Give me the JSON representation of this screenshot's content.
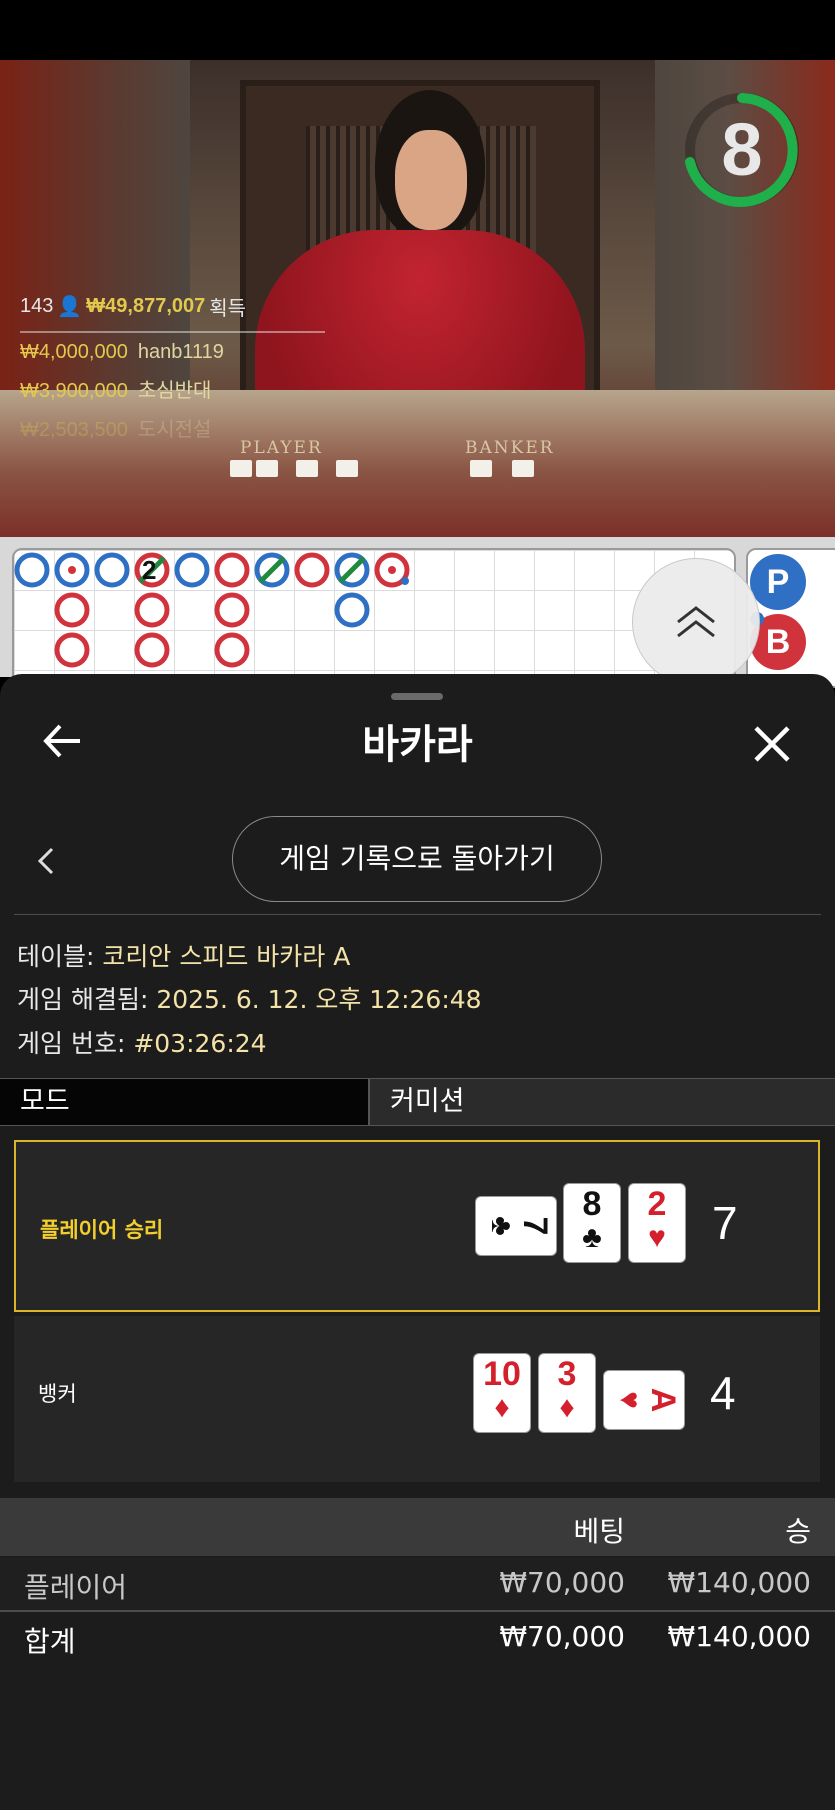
{
  "video": {
    "timer": "8",
    "table_labels": {
      "player": "PLAYER",
      "banker": "BANKER"
    },
    "winners": {
      "count": "143",
      "total": "₩49,877,007",
      "total_suffix": "획득",
      "list": [
        {
          "amount": "₩4,000,000",
          "name": "hanb1119"
        },
        {
          "amount": "₩3,900,000",
          "name": "초심반대"
        },
        {
          "amount": "₩2,503,500",
          "name": "도시전설"
        }
      ]
    }
  },
  "roadmap": {
    "side_labels": {
      "player": "P",
      "banker": "B"
    },
    "tie_count": "2"
  },
  "header": {
    "title": "바카라"
  },
  "history_button": "게임 기록으로 돌아가기",
  "info": {
    "table_label": "테이블:",
    "table_value": "코리안 스피드 바카라 A",
    "resolved_label": "게임 해결됨:",
    "resolved_value": "2025. 6. 12. 오후 12:26:48",
    "number_label": "게임 번호:",
    "number_value": "#03:26:24"
  },
  "tabs": {
    "mode": "모드",
    "commission": "커미션"
  },
  "results": {
    "player": {
      "label": "플레이어 승리",
      "cards": [
        {
          "rank": "7",
          "suit": "♣"
        },
        {
          "rank": "8",
          "suit": "♣"
        },
        {
          "rank": "2",
          "suit": "♥"
        }
      ],
      "score": "7"
    },
    "banker": {
      "label": "뱅커",
      "cards": [
        {
          "rank": "10",
          "suit": "♦"
        },
        {
          "rank": "3",
          "suit": "♦"
        },
        {
          "rank": "A",
          "suit": "♥"
        }
      ],
      "score": "4"
    }
  },
  "bets": {
    "headers": {
      "bet": "베팅",
      "win": "승"
    },
    "rows": [
      {
        "name": "플레이어",
        "bet": "₩70,000",
        "win": "₩140,000"
      }
    ],
    "total": {
      "name": "합계",
      "bet": "₩70,000",
      "win": "₩140,000"
    }
  },
  "colors": {
    "accent_yellow": "#f2cf2b",
    "player_blue": "#2f6fc4",
    "banker_red": "#d0333b",
    "timer_green": "#1fb04b"
  }
}
